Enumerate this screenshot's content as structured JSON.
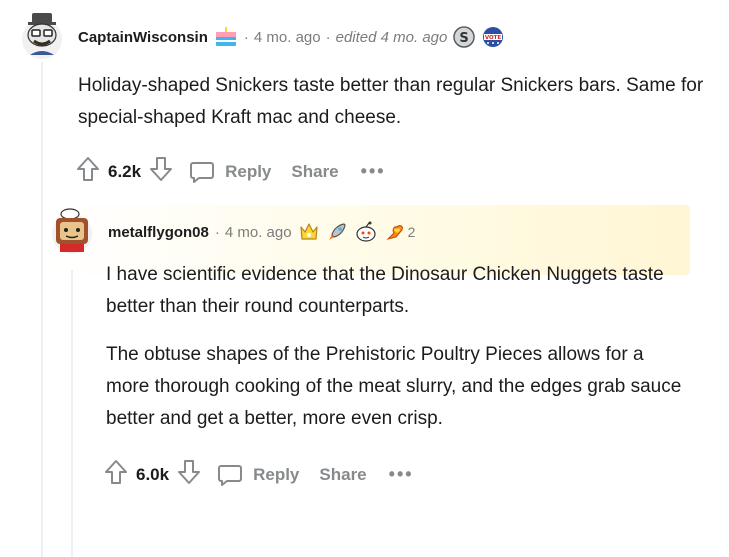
{
  "comments": [
    {
      "username": "CaptainWisconsin",
      "time": "4 mo. ago",
      "edited": "edited 4 mo. ago",
      "body": [
        "Holiday-shaped Snickers taste better than regular Snickers bars. Same for special-shaped Kraft mac and cheese."
      ],
      "votes": "6.2k",
      "reply_label": "Reply",
      "share_label": "Share",
      "more_label": "•••",
      "flair_icons": [
        "cake-icon"
      ],
      "awards": [
        "silver-coin-icon",
        "vote-badge-icon"
      ]
    },
    {
      "username": "metalflygon08",
      "time": "4 mo. ago",
      "body": [
        "I have scientific evidence that the Dinosaur Chicken Nuggets taste better than their round counterparts.",
        "The obtuse shapes of the Prehistoric Poultry Pieces allows for a more thorough cooking of the meat slurry, and the edges grab sauce better and get a better, more even crisp."
      ],
      "votes": "6.0k",
      "reply_label": "Reply",
      "share_label": "Share",
      "more_label": "•••",
      "awards": [
        "crown-award-icon",
        "rocket-award-icon",
        "snoo-award-icon",
        "heart-hand-award-icon"
      ],
      "award_count": "2"
    }
  ]
}
